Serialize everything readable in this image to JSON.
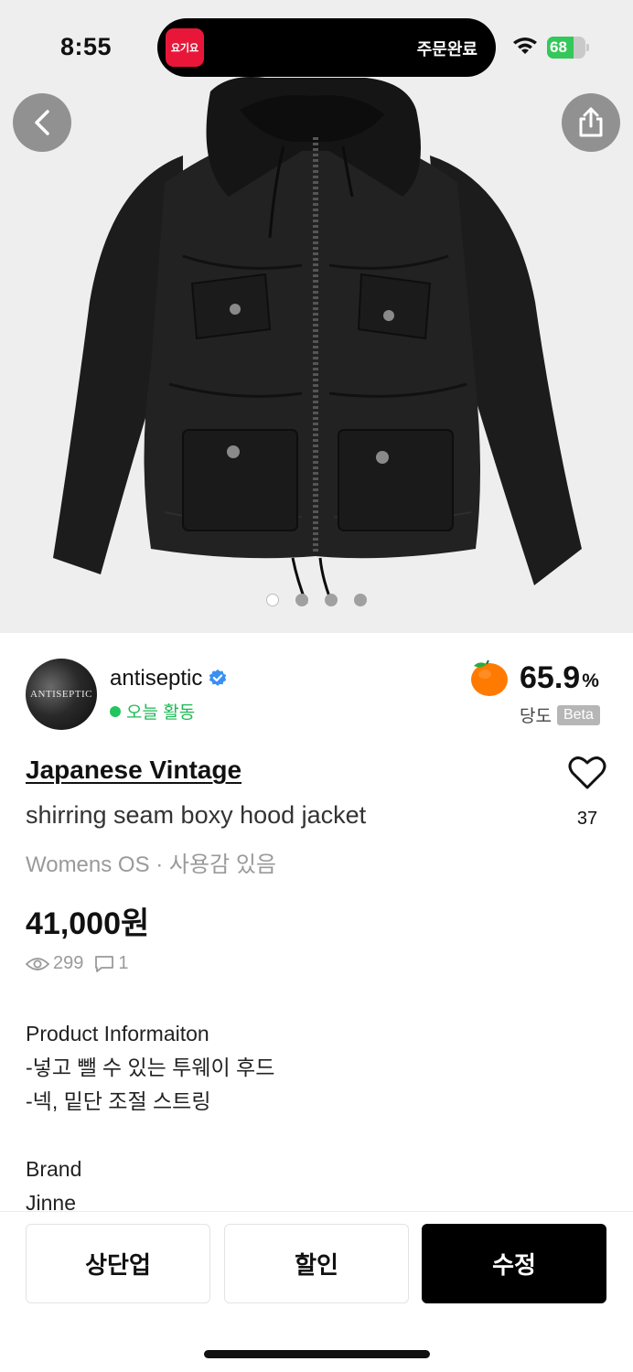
{
  "status_bar": {
    "time": "8:55",
    "live_activity_app": "요기요",
    "live_activity_text": "주문완료",
    "battery": "68",
    "battery_level": 0.68
  },
  "gallery": {
    "image_count": 4,
    "active_index": 0,
    "back_icon": "chevron-left-icon",
    "share_icon": "share-icon"
  },
  "seller": {
    "name": "antiseptic",
    "avatar_text": "ANTISEPTIC",
    "activity": "오늘 활동",
    "sweetness_value": "65.9",
    "sweetness_unit": "%",
    "sweetness_label": "당도",
    "beta": "Beta"
  },
  "product": {
    "brand": "Japanese Vintage",
    "title": "shirring seam boxy hood jacket",
    "meta": "Womens OS · 사용감 있음",
    "price": "41,000원",
    "likes": "37",
    "views": "299",
    "comments": "1",
    "description": [
      "Product Informaiton",
      "-넣고 뺄 수 있는 투웨이 후드",
      "-넥, 밑단 조절 스트링",
      "",
      "Brand",
      "Jinne"
    ]
  },
  "actions": {
    "bump": "상단업",
    "discount": "할인",
    "edit": "수정"
  },
  "colors": {
    "accent_green": "#1db954",
    "verified_blue": "#3b8ff3",
    "primary_button": "#000000"
  }
}
